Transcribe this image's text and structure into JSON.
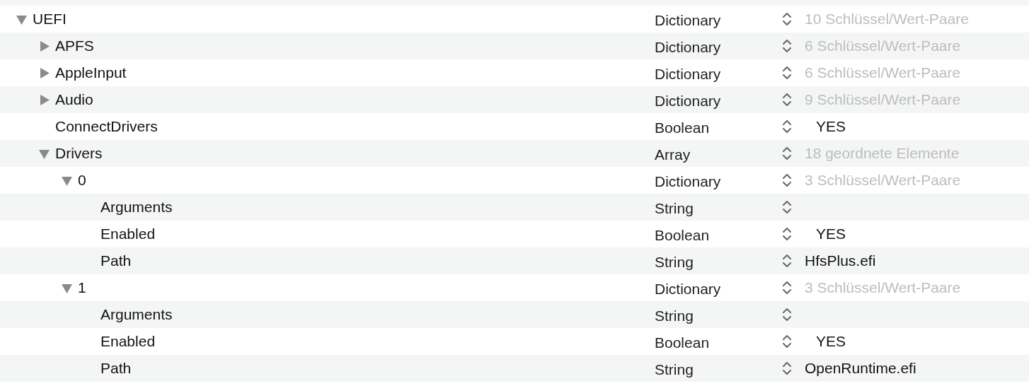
{
  "rows": [
    {
      "key": "UEFI",
      "type": "Dictionary",
      "value": "10 Schlüssel/Wert-Paare",
      "kind": "summary",
      "expanded": true,
      "children": [
        {
          "key": "APFS",
          "type": "Dictionary",
          "value": "6 Schlüssel/Wert-Paare",
          "kind": "summary",
          "expanded": false
        },
        {
          "key": "AppleInput",
          "type": "Dictionary",
          "value": "6 Schlüssel/Wert-Paare",
          "kind": "summary",
          "expanded": false
        },
        {
          "key": "Audio",
          "type": "Dictionary",
          "value": "9 Schlüssel/Wert-Paare",
          "kind": "summary",
          "expanded": false
        },
        {
          "key": "ConnectDrivers",
          "type": "Boolean",
          "value": "YES",
          "kind": "boolean"
        },
        {
          "key": "Drivers",
          "type": "Array",
          "value": "18 geordnete Elemente",
          "kind": "summary",
          "expanded": true,
          "children": [
            {
              "key": "0",
              "type": "Dictionary",
              "value": "3 Schlüssel/Wert-Paare",
              "kind": "summary",
              "expanded": true,
              "children": [
                {
                  "key": "Arguments",
                  "type": "String"
                },
                {
                  "key": "Enabled",
                  "type": "Boolean",
                  "value": "YES",
                  "kind": "boolean"
                },
                {
                  "key": "Path",
                  "type": "String",
                  "value": "HfsPlus.efi",
                  "kind": "text"
                }
              ]
            },
            {
              "key": "1",
              "type": "Dictionary",
              "value": "3 Schlüssel/Wert-Paare",
              "kind": "summary",
              "expanded": true,
              "children": [
                {
                  "key": "Arguments",
                  "type": "String"
                },
                {
                  "key": "Enabled",
                  "type": "Boolean",
                  "value": "YES",
                  "kind": "boolean"
                },
                {
                  "key": "Path",
                  "type": "String",
                  "value": "OpenRuntime.efi",
                  "kind": "text"
                }
              ]
            }
          ]
        }
      ]
    }
  ]
}
